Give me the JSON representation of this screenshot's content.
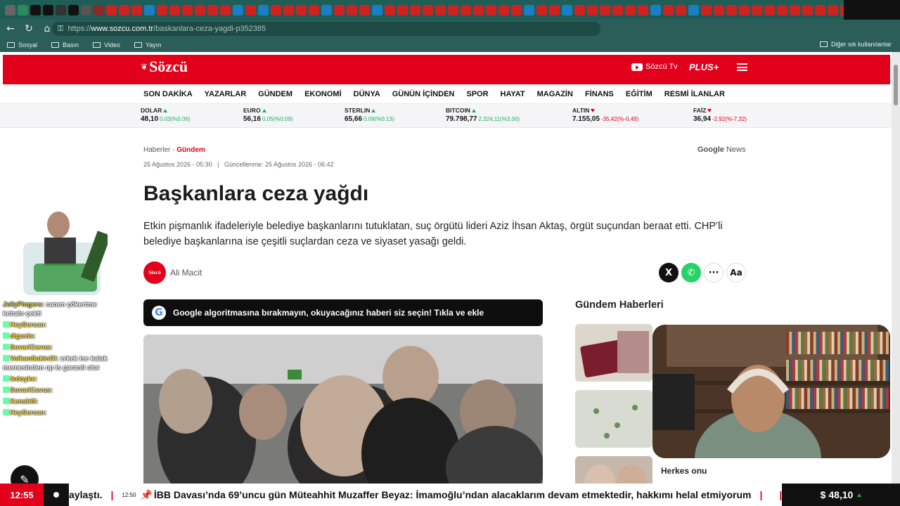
{
  "browser": {
    "url_prefix": "https://",
    "url_host": "www.sozcu.com.tr",
    "url_path": "/baskanlara-ceza-yagdi-p352385",
    "new_tab": "+",
    "bookmarks": [
      "Sosyal",
      "Basın",
      "Video",
      "Yayın"
    ],
    "other_bookmarks": "Diğer sık kullanılanlar",
    "colors": {
      "chrome": "#1f5e56",
      "toolbar": "#2b5e58"
    }
  },
  "site": {
    "logo": "Sözcü",
    "tv": "Sözcü Tv",
    "plus": "PLUS+",
    "brand_color": "#e3001b",
    "nav": [
      "SON DAKİKA",
      "YAZARLAR",
      "GÜNDEM",
      "EKONOMİ",
      "DÜNYA",
      "GÜNÜN İÇİNDEN",
      "SPOR",
      "HAYAT",
      "MAGAZİN",
      "FİNANS",
      "EĞİTİM",
      "RESMİ İLANLAR"
    ]
  },
  "markets": [
    {
      "name": "DOLAR",
      "value": "48,10",
      "change": "0.03(%0.06)",
      "dir": "up"
    },
    {
      "name": "EURO",
      "value": "56,16",
      "change": "0.05(%0.09)",
      "dir": "up"
    },
    {
      "name": "STERLIN",
      "value": "65,66",
      "change": "0.09(%0.13)",
      "dir": "up"
    },
    {
      "name": "BITCOIN",
      "value": "79.798,77",
      "change": "2.324,11(%3,00)",
      "dir": "up"
    },
    {
      "name": "ALTIN",
      "value": "7.155,05",
      "change": "-35,42(%-0,49)",
      "dir": "down"
    },
    {
      "name": "FAİZ",
      "value": "36,94",
      "change": "-2,92(%-7,32)",
      "dir": "down"
    }
  ],
  "article": {
    "breadcrumb_home": "Haberler -",
    "breadcrumb_category": "Gündem",
    "google_news_google": "Google",
    "google_news_news": "News",
    "published": "25 Ağustos 2026 - 05:30",
    "separator": "|",
    "updated": "Güncellenme: 25 Ağustos 2026 - 06:42",
    "title": "Başkanlara ceza yağdı",
    "lead": "Etkin pişmanlık ifadeleriyle belediye başkanlarını tutuklatan, suç örgütü lideri Aziz İhsan Aktaş, örgüt suçundan beraat etti. CHP’li belediye başkanlarına ise çeşitli suçlardan ceza ve siyaset yasağı geldi.",
    "author_badge": "Sözcü",
    "author": "Ali Macit",
    "share_more": "···",
    "font_size": "Aa",
    "google_banner": "Google algoritmasına bırakmayın, okuyacağınız haberi siz seçin! Tıkla ve ekle"
  },
  "sidebar": {
    "title": "Gündem Haberleri",
    "caption_partial": "Herkes onu"
  },
  "stream_chat": [
    {
      "user": "JellyFingers:",
      "msg": "canım çökertme kebabı çekti"
    },
    {
      "user": "HeySercan:",
      "msg": ""
    },
    {
      "user": "diguxis:",
      "msg": ""
    },
    {
      "user": "SuvariCavus:",
      "msg": ""
    },
    {
      "user": "VolkanSakinOl:",
      "msg": "erkek ise kalak memesinden op is garanti olur"
    },
    {
      "user": "fedoyke:",
      "msg": ""
    },
    {
      "user": "SuvariCavus:",
      "msg": ""
    },
    {
      "user": "Kenshi9:",
      "msg": ""
    },
    {
      "user": "HeySercan:",
      "msg": ""
    }
  ],
  "bottom_bar": {
    "clock": "12:55",
    "headline_prev": "aylaştı.",
    "separator": "|",
    "time": "12:50",
    "pin": "📌",
    "headline": "İBB Davası’nda 69’uncu gün Müteahhit Muzaffer Beyaz: İmamoğlu’ndan alacaklarım devam etmektedir, hakkımı helal etmiyorum",
    "currency_symbol": "$",
    "currency_value": "48,10"
  }
}
